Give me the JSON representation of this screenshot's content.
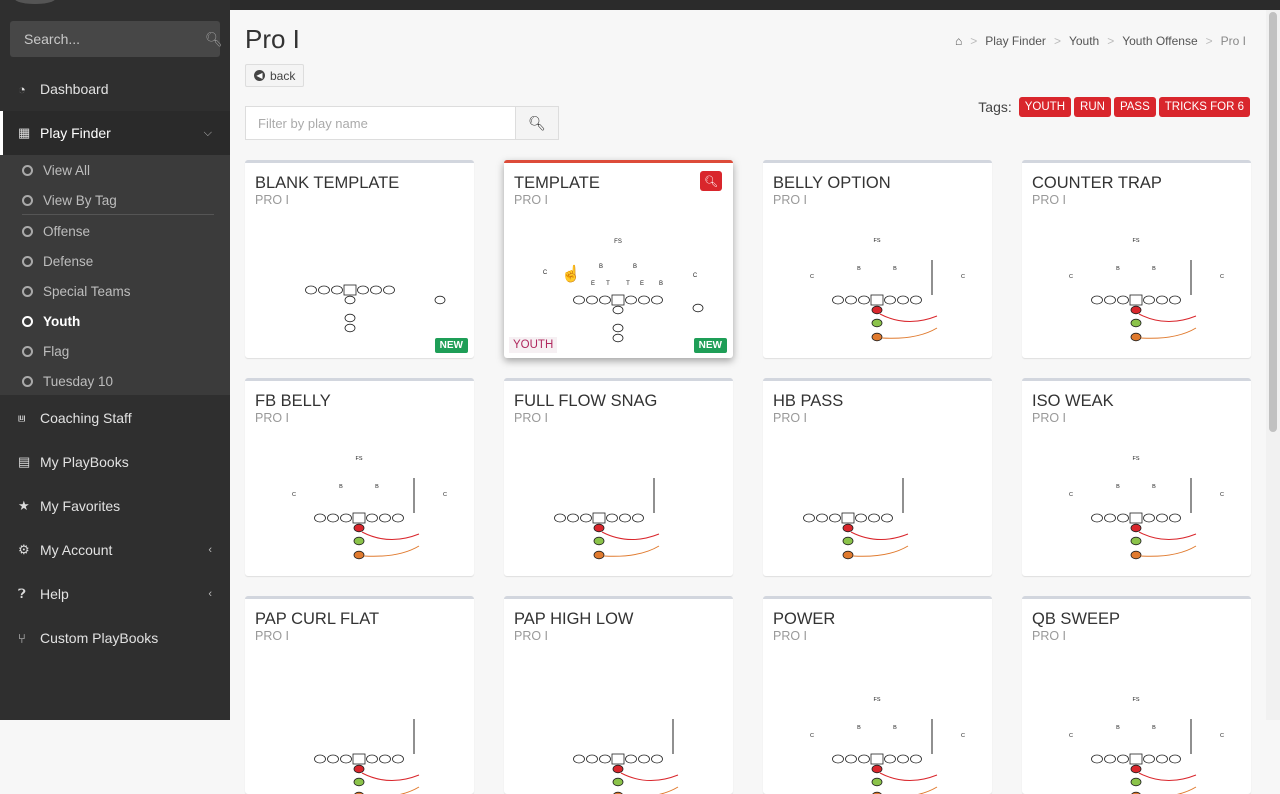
{
  "sidebar": {
    "search_placeholder": "Search...",
    "items": [
      {
        "label": "Dashboard",
        "icon": "dashboard-icon"
      },
      {
        "label": "Play Finder",
        "icon": "grid-icon",
        "expanded": true
      },
      {
        "label": "Coaching Staff",
        "icon": "rss-icon"
      },
      {
        "label": "My PlayBooks",
        "icon": "book-icon"
      },
      {
        "label": "My Favorites",
        "icon": "star-icon"
      },
      {
        "label": "My Account",
        "icon": "gear-icon"
      },
      {
        "label": "Help",
        "icon": "question-icon"
      },
      {
        "label": "Custom PlayBooks",
        "icon": "branch-icon"
      }
    ],
    "submenu": [
      {
        "label": "View All"
      },
      {
        "label": "View By Tag"
      },
      {
        "label": "Offense"
      },
      {
        "label": "Defense"
      },
      {
        "label": "Special Teams"
      },
      {
        "label": "Youth",
        "active": true
      },
      {
        "label": "Flag"
      },
      {
        "label": "Tuesday 10"
      }
    ]
  },
  "header": {
    "title": "Pro I",
    "back_label": "back",
    "breadcrumb": [
      "Play Finder",
      "Youth",
      "Youth Offense",
      "Pro I"
    ],
    "filter_placeholder": "Filter by play name",
    "tags_label": "Tags:",
    "tags": [
      "YOUTH",
      "RUN",
      "PASS",
      "TRICKS FOR 6"
    ]
  },
  "cards": [
    {
      "title": "BLANK TEMPLATE",
      "formation": "PRO I",
      "badge": "NEW"
    },
    {
      "title": "TEMPLATE",
      "formation": "PRO I",
      "badge": "NEW",
      "tag": "YOUTH",
      "selected": true
    },
    {
      "title": "BELLY OPTION",
      "formation": "PRO I"
    },
    {
      "title": "COUNTER TRAP",
      "formation": "PRO I"
    },
    {
      "title": "FB BELLY",
      "formation": "PRO I"
    },
    {
      "title": "FULL FLOW SNAG",
      "formation": "PRO I"
    },
    {
      "title": "HB PASS",
      "formation": "PRO I"
    },
    {
      "title": "ISO WEAK",
      "formation": "PRO I"
    },
    {
      "title": "PAP CURL FLAT",
      "formation": "PRO I"
    },
    {
      "title": "PAP HIGH LOW",
      "formation": "PRO I"
    },
    {
      "title": "POWER",
      "formation": "PRO I"
    },
    {
      "title": "QB SWEEP",
      "formation": "PRO I"
    }
  ],
  "colors": {
    "accent": "#d9262c",
    "new_badge": "#1e9e57",
    "sidebar_bg": "#2f2f2f"
  }
}
